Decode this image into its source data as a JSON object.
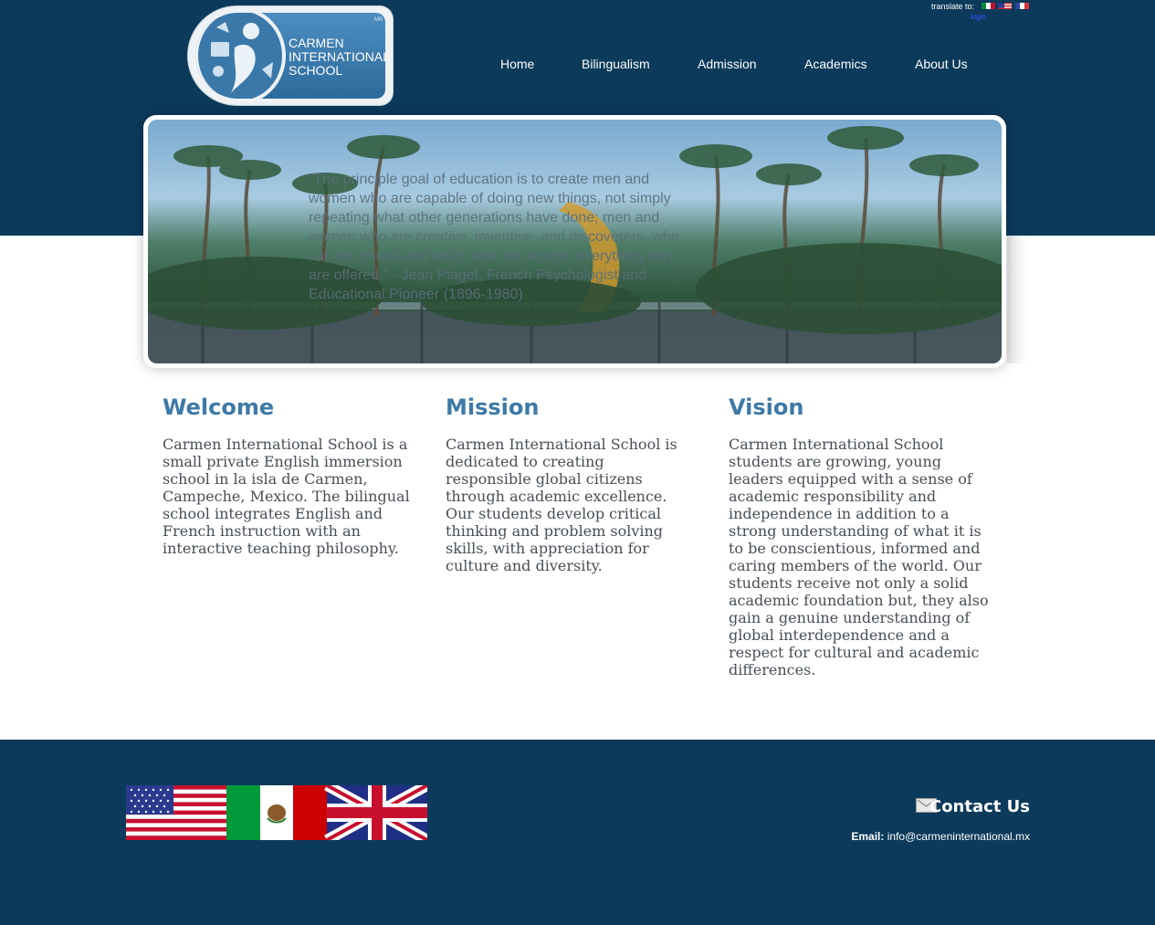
{
  "logo": {
    "line1": "CARMEN",
    "line2": "INTERNATIONAL",
    "line3": "SCHOOL",
    "mark": "MR"
  },
  "translate": {
    "label": "translate to:",
    "languages": [
      "mexico-flag-icon",
      "usa-flag-icon",
      "france-flag-icon"
    ],
    "login": "login"
  },
  "nav": {
    "items": [
      "Home",
      "Bilingualism",
      "Admission",
      "Academics",
      "About Us"
    ]
  },
  "banner": {
    "quote": "\"The principle goal of education is to create men and women who are capable of doing new things, not simply repeating what other generations have done; men and women who are creative, inventive, and discoverers, who can be critical and verify, and not accept, everything they are offered.\" - Jean Piaget, French Psychologist and Educational Pioneer (1896-1980)"
  },
  "columns": [
    {
      "title": "Welcome",
      "body": "Carmen International School is a small private English immersion school in la isla de Carmen, Campeche, Mexico. The bilingual school integrates English and French instruction with an interactive teaching philosophy."
    },
    {
      "title": "Mission",
      "body": "Carmen International School is dedicated to creating responsible global citizens through academic excellence. Our students develop critical thinking and problem solving skills, with appreciation for culture and diversity."
    },
    {
      "title": "Vision",
      "body": "Carmen International School students are growing, young leaders equipped with a sense of academic responsibility and independence in addition to a strong understanding of what it is to be conscientious, informed and caring members of the world. Our students receive not only a solid academic foundation but, they also gain a genuine understanding of global interdependence and a respect for cultural and academic differences."
    }
  ],
  "footer": {
    "flags": [
      "usa-flag-icon",
      "mexico-flag-icon",
      "uk-flag-icon"
    ],
    "contact_label": "Contact Us",
    "email_label": "Email:",
    "email_value": "info@carmeninternational.mx"
  },
  "colors": {
    "brand_navy": "#0c3a5a",
    "heading_blue": "#3d7aa8",
    "body_text": "#474f56"
  }
}
